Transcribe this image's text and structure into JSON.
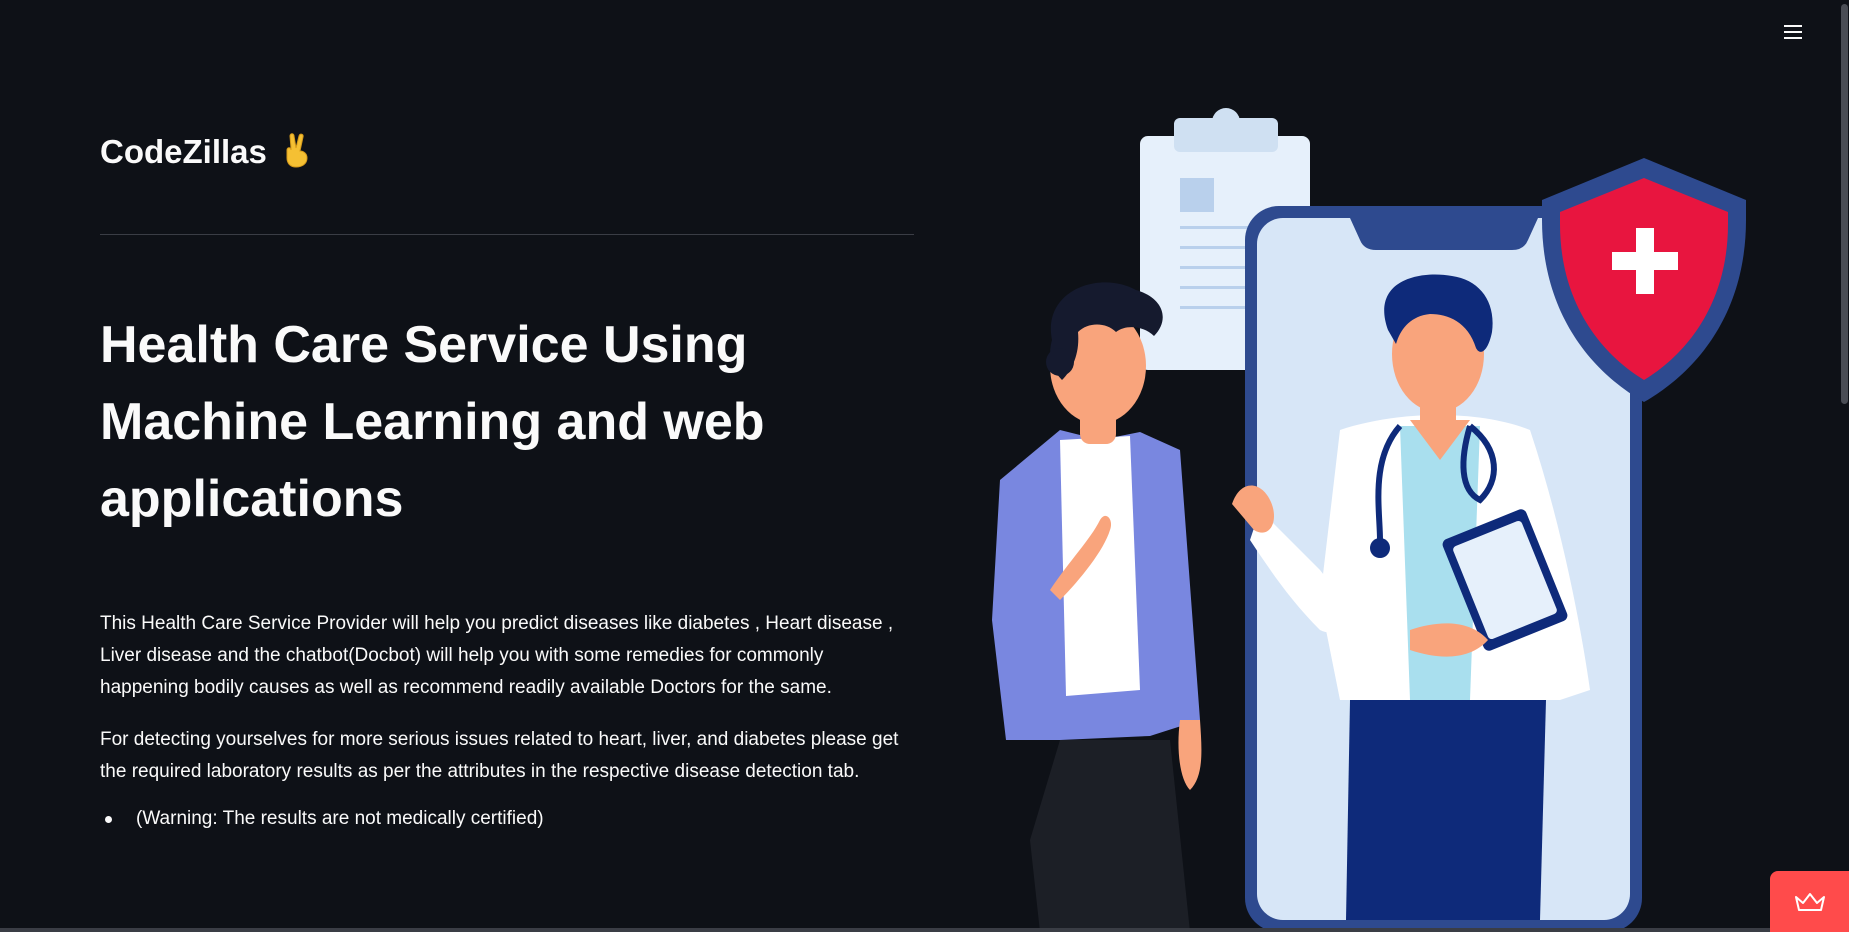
{
  "brand": {
    "name": "CodeZillas",
    "emoji": "✌️"
  },
  "headline": "Health Care Service Using Machine Learning and web applications",
  "paragraphs": [
    "This Health Care Service Provider will help you predict diseases like diabetes , Heart disease , Liver disease and the chatbot(Docbot) will help you with some remedies for commonly happening bodily causes as well as recommend readily available Doctors for the same.",
    "For detecting yourselves for more serious issues related to heart, liver, and diabetes please get the required laboratory results as per the attributes in the respective disease detection tab."
  ],
  "bullets": [
    "(Warning: The results are not medically certified)"
  ],
  "icons": {
    "menu": "hamburger-menu-icon",
    "badge": "crown-icon"
  },
  "colors": {
    "background": "#0e1117",
    "text": "#fafafa",
    "accent": "#ff4b4b"
  }
}
